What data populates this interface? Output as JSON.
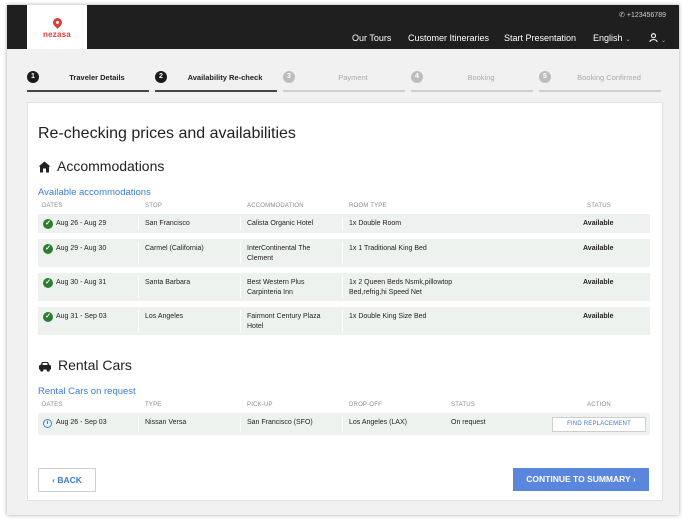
{
  "header": {
    "logo_text": "nezasa",
    "phone": "+123456789",
    "nav": [
      "Our Tours",
      "Customer Itineraries",
      "Start Presentation",
      "English"
    ]
  },
  "steps": [
    {
      "num": "1",
      "label": "Traveler Details"
    },
    {
      "num": "2",
      "label": "Availability Re-check"
    },
    {
      "num": "3",
      "label": "Payment"
    },
    {
      "num": "4",
      "label": "Booking"
    },
    {
      "num": "5",
      "label": "Booking Confirmed"
    }
  ],
  "page_title": "Re-checking prices and availabilities",
  "accommodations": {
    "heading": "Accommodations",
    "sublink": "Available accommodations",
    "columns": [
      "DATES",
      "STOP",
      "ACCOMMODATION",
      "ROOM TYPE",
      "STATUS"
    ],
    "rows": [
      {
        "dates": "Aug 26 - Aug 29",
        "stop": "San Francisco",
        "accommodation": "Calista Organic Hotel",
        "room": "1x Double Room",
        "status": "Available"
      },
      {
        "dates": "Aug 29 - Aug 30",
        "stop": "Carmel (California)",
        "accommodation": "InterContinental The Clement",
        "room": "1x 1 Traditional King Bed",
        "status": "Available"
      },
      {
        "dates": "Aug 30 - Aug 31",
        "stop": "Santa Barbara",
        "accommodation": "Best Western Plus Carpinteria Inn",
        "room": "1x 2 Queen Beds Nsmk,pillowtop Bed,refrig,hi Speed Net",
        "status": "Available"
      },
      {
        "dates": "Aug 31 - Sep 03",
        "stop": "Los Angeles",
        "accommodation": "Fairmont Century Plaza Hotel",
        "room": "1x Double King Size Bed",
        "status": "Available"
      }
    ]
  },
  "rental_cars": {
    "heading": "Rental Cars",
    "sublink": "Rental Cars on request",
    "columns": [
      "DATES",
      "TYPE",
      "PICK-UP",
      "DROP-OFF",
      "STATUS",
      "ACTION"
    ],
    "rows": [
      {
        "dates": "Aug 26 - Sep 03",
        "type": "Nissan Versa",
        "pickup": "San Francisco (SFO)",
        "dropoff": "Los Angeles (LAX)",
        "status": "On request",
        "action": "FIND REPLACEMENT"
      }
    ]
  },
  "buttons": {
    "back": "BACK",
    "continue": "CONTINUE TO SUMMARY"
  },
  "colors": {
    "accent": "#3b7bd6",
    "primary_button": "#5b86dd",
    "available_check": "#2e7d32",
    "header_bg": "#1f1f1f",
    "brand": "#e23b3b"
  }
}
